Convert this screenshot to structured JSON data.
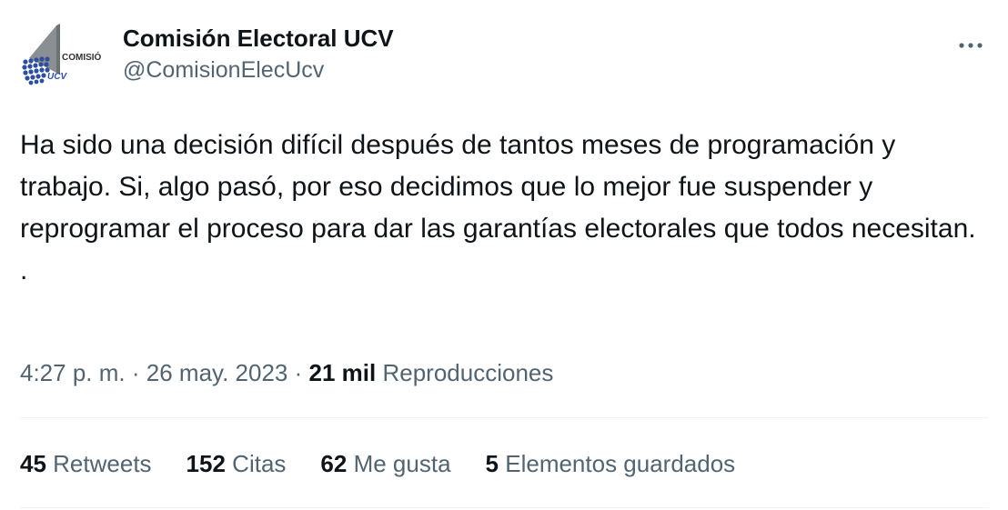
{
  "account": {
    "display_name": "Comisión Electoral UCV",
    "handle": "@ComisionElecUcv",
    "avatar_text_top": "COMISIÓN",
    "avatar_text_bottom": "UCV"
  },
  "tweet": {
    "text": "Ha sido una decisión difícil después de tantos meses de programación y trabajo. Si, algo pasó, por eso decidimos que lo mejor fue suspender y reprogramar el proceso para dar las garantías electorales que todos necesitan.\n.",
    "time": "4:27 p. m.",
    "separator": "·",
    "date": "26 may. 2023",
    "views_count": "21 mil",
    "views_label": "Reproducciones"
  },
  "stats": [
    {
      "count": "45",
      "label": "Retweets"
    },
    {
      "count": "152",
      "label": "Citas"
    },
    {
      "count": "62",
      "label": "Me gusta"
    },
    {
      "count": "5",
      "label": "Elementos guardados"
    }
  ],
  "icons": {
    "more": "more-horizontal-icon"
  },
  "colors": {
    "text_primary": "#0f1419",
    "text_secondary": "#536471",
    "divider": "#eff3f4"
  }
}
